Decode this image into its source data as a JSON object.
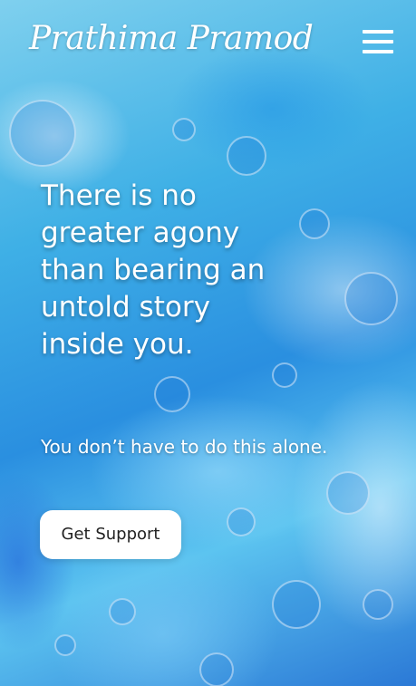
{
  "header": {
    "logo_text": "Prathima Pramod",
    "menu_icon": "hamburger-menu-icon"
  },
  "hero": {
    "headline_lines": [
      "There is no",
      "greater agony",
      "than bearing an",
      "untold story",
      "inside you."
    ],
    "subline": "You don’t have to do this alone.",
    "cta_label": "Get Support"
  },
  "colors": {
    "text": "#ffffff",
    "button_background": "#ffffff",
    "button_text": "#222222",
    "background_accent": "#2a8fe0"
  }
}
